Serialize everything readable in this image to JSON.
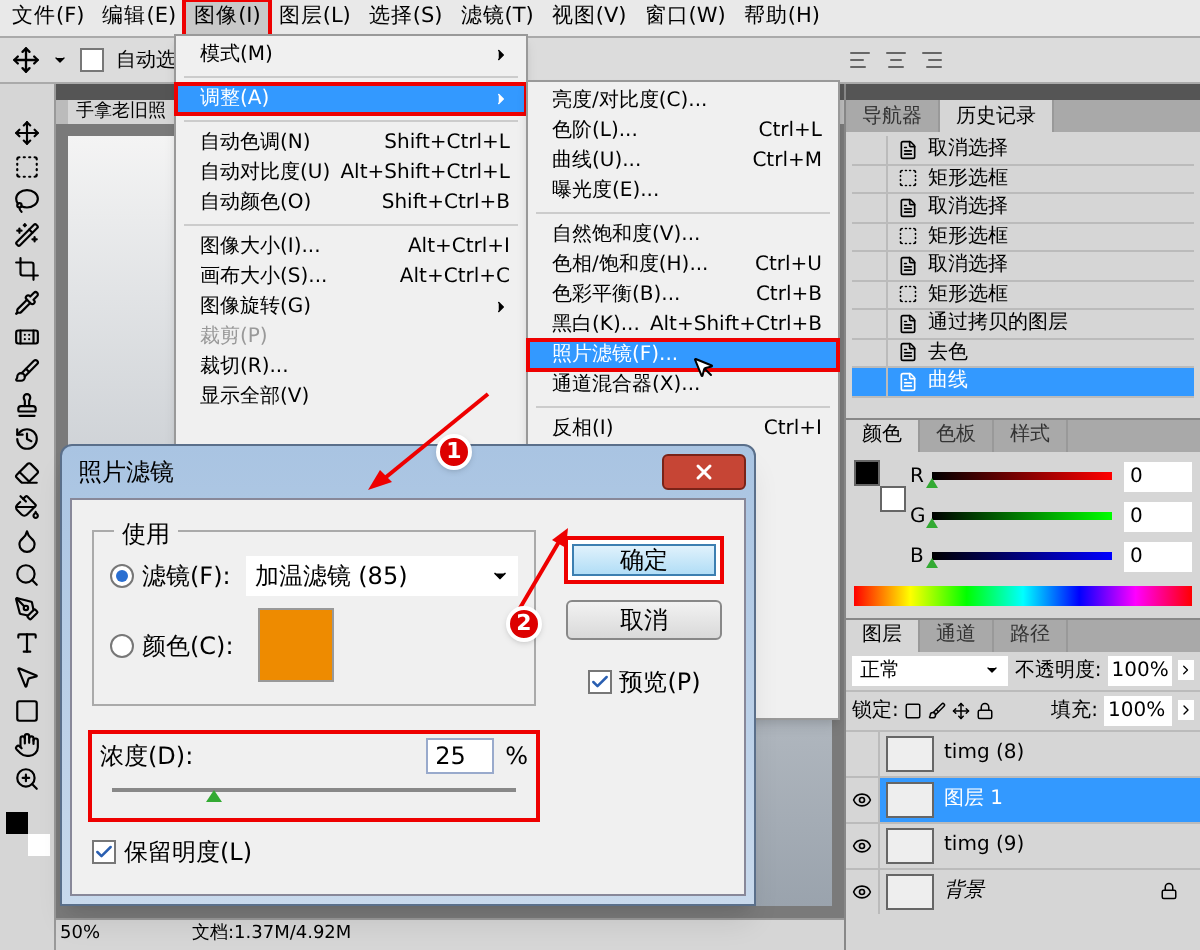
{
  "menubar": [
    {
      "label": "文件(F)",
      "selected": false
    },
    {
      "label": "编辑(E)",
      "selected": false
    },
    {
      "label": "图像(I)",
      "selected": true
    },
    {
      "label": "图层(L)",
      "selected": false
    },
    {
      "label": "选择(S)",
      "selected": false
    },
    {
      "label": "滤镜(T)",
      "selected": false
    },
    {
      "label": "视图(V)",
      "selected": false
    },
    {
      "label": "窗口(W)",
      "selected": false
    },
    {
      "label": "帮助(H)",
      "selected": false
    }
  ],
  "options_bar": {
    "auto_select": {
      "label": "自动选",
      "checked": false
    }
  },
  "document_tab": {
    "title": "手拿老旧照"
  },
  "image_menu": [
    {
      "kind": "item",
      "label": "模式(M)",
      "submenu": true,
      "selected": false,
      "disabled": false,
      "boxed": false
    },
    {
      "kind": "separator"
    },
    {
      "kind": "item",
      "label": "调整(A)",
      "submenu": true,
      "selected": true,
      "disabled": false,
      "boxed": true
    },
    {
      "kind": "separator"
    },
    {
      "kind": "item",
      "label": "自动色调(N)",
      "shortcut": "Shift+Ctrl+L",
      "submenu": false,
      "selected": false,
      "disabled": false,
      "boxed": false
    },
    {
      "kind": "item",
      "label": "自动对比度(U)",
      "shortcut": "Alt+Shift+Ctrl+L",
      "submenu": false,
      "selected": false,
      "disabled": false,
      "boxed": false
    },
    {
      "kind": "item",
      "label": "自动颜色(O)",
      "shortcut": "Shift+Ctrl+B",
      "submenu": false,
      "selected": false,
      "disabled": false,
      "boxed": false
    },
    {
      "kind": "separator"
    },
    {
      "kind": "item",
      "label": "图像大小(I)...",
      "shortcut": "Alt+Ctrl+I",
      "submenu": false,
      "selected": false,
      "disabled": false,
      "boxed": false
    },
    {
      "kind": "item",
      "label": "画布大小(S)...",
      "shortcut": "Alt+Ctrl+C",
      "submenu": false,
      "selected": false,
      "disabled": false,
      "boxed": false
    },
    {
      "kind": "item",
      "label": "图像旋转(G)",
      "submenu": true,
      "selected": false,
      "disabled": false,
      "boxed": false
    },
    {
      "kind": "item",
      "label": "裁剪(P)",
      "submenu": false,
      "selected": false,
      "disabled": true,
      "boxed": false
    },
    {
      "kind": "item",
      "label": "裁切(R)...",
      "submenu": false,
      "selected": false,
      "disabled": false,
      "boxed": false
    },
    {
      "kind": "item",
      "label": "显示全部(V)",
      "submenu": false,
      "selected": false,
      "disabled": false,
      "boxed": false
    }
  ],
  "adjust_menu": [
    {
      "kind": "item",
      "label": "亮度/对比度(C)...",
      "selected": false,
      "boxed": false
    },
    {
      "kind": "item",
      "label": "色阶(L)...",
      "shortcut": "Ctrl+L",
      "selected": false,
      "boxed": false
    },
    {
      "kind": "item",
      "label": "曲线(U)...",
      "shortcut": "Ctrl+M",
      "selected": false,
      "boxed": false
    },
    {
      "kind": "item",
      "label": "曝光度(E)...",
      "selected": false,
      "boxed": false
    },
    {
      "kind": "separator"
    },
    {
      "kind": "item",
      "label": "自然饱和度(V)...",
      "selected": false,
      "boxed": false
    },
    {
      "kind": "item",
      "label": "色相/饱和度(H)...",
      "shortcut": "Ctrl+U",
      "selected": false,
      "boxed": false
    },
    {
      "kind": "item",
      "label": "色彩平衡(B)...",
      "shortcut": "Ctrl+B",
      "selected": false,
      "boxed": false
    },
    {
      "kind": "item",
      "label": "黑白(K)...",
      "shortcut": "Alt+Shift+Ctrl+B",
      "selected": false,
      "boxed": false
    },
    {
      "kind": "item",
      "label": "照片滤镜(F)...",
      "selected": true,
      "boxed": true
    },
    {
      "kind": "item",
      "label": "通道混合器(X)...",
      "selected": false,
      "boxed": false
    },
    {
      "kind": "separator"
    },
    {
      "kind": "item",
      "label": "反相(I)",
      "shortcut": "Ctrl+I",
      "selected": false,
      "boxed": false
    }
  ],
  "dialog": {
    "title": "照片滤镜",
    "group_title": "使用",
    "filter_option": {
      "label": "滤镜(F):",
      "selected": true,
      "value": "加温滤镜 (85)"
    },
    "color_option": {
      "label": "颜色(C):",
      "selected": false,
      "color": "#ee8b00"
    },
    "density": {
      "label": "浓度(D):",
      "value": "25",
      "unit": "%",
      "level": 0.25,
      "boxed": true
    },
    "preserve_luminosity": {
      "label": "保留明度(L)",
      "checked": true
    },
    "ok_button": {
      "label": "确定",
      "boxed": true
    },
    "cancel_button": {
      "label": "取消"
    },
    "preview": {
      "label": "预览(P)",
      "checked": true
    }
  },
  "step_markers": [
    {
      "label": "1"
    },
    {
      "label": "2"
    }
  ],
  "history_panel": {
    "tabs": [
      {
        "label": "导航器",
        "selected": false
      },
      {
        "label": "历史记录",
        "selected": true
      }
    ],
    "items": [
      {
        "kind": "command",
        "label": "取消选择",
        "selected": false
      },
      {
        "kind": "marquee",
        "label": "矩形选框",
        "selected": false
      },
      {
        "kind": "command",
        "label": "取消选择",
        "selected": false
      },
      {
        "kind": "marquee",
        "label": "矩形选框",
        "selected": false
      },
      {
        "kind": "command",
        "label": "取消选择",
        "selected": false
      },
      {
        "kind": "marquee",
        "label": "矩形选框",
        "selected": false
      },
      {
        "kind": "command",
        "label": "通过拷贝的图层",
        "selected": false
      },
      {
        "kind": "command",
        "label": "去色",
        "selected": false
      },
      {
        "kind": "command",
        "label": "曲线",
        "selected": true
      }
    ]
  },
  "color_panel": {
    "tabs": [
      {
        "label": "颜色",
        "selected": true
      },
      {
        "label": "色板",
        "selected": false
      },
      {
        "label": "样式",
        "selected": false
      }
    ],
    "channels": [
      {
        "name": "R",
        "value": "0",
        "level": 0
      },
      {
        "name": "G",
        "value": "0",
        "level": 0
      },
      {
        "name": "B",
        "value": "0",
        "level": 0
      }
    ]
  },
  "layers_panel": {
    "tabs": [
      {
        "label": "图层",
        "selected": true
      },
      {
        "label": "通道",
        "selected": false
      },
      {
        "label": "路径",
        "selected": false
      }
    ],
    "blend_mode": "正常",
    "opacity_label": "不透明度:",
    "opacity": "100%",
    "lock_label": "锁定:",
    "fill_label": "填充:",
    "fill": "100%",
    "layers": [
      {
        "name": "timg (8)",
        "visible": false,
        "selected": false,
        "locked": false
      },
      {
        "name": "图层 1",
        "visible": true,
        "selected": true,
        "locked": false
      },
      {
        "name": "timg (9)",
        "visible": true,
        "selected": false,
        "locked": false
      },
      {
        "name": "背景",
        "visible": true,
        "selected": false,
        "locked": true
      }
    ]
  },
  "status_bar": {
    "zoom": "50%",
    "document": "文档:1.37M/4.92M"
  }
}
